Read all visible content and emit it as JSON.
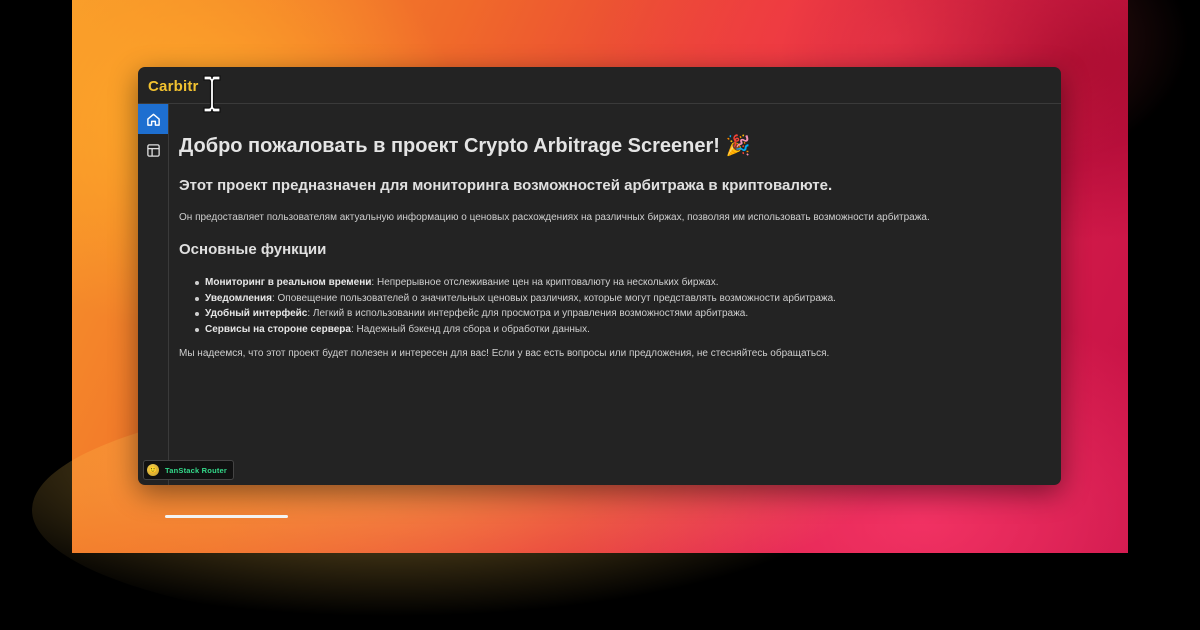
{
  "app": {
    "brand": "Carbitr"
  },
  "sidebar": {
    "items": [
      {
        "icon": "home-icon",
        "active": true
      },
      {
        "icon": "table-icon",
        "active": false
      }
    ]
  },
  "main": {
    "title": "Добро пожаловать в проект Crypto Arbitrage Screener! 🎉",
    "subtitle": "Этот проект предназначен для мониторинга возможностей арбитража в криптовалюте.",
    "intro": "Он предоставляет пользователям актуальную информацию о ценовых расхождениях на различных биржах, позволяя им использовать возможности арбитража.",
    "features_heading": "Основные функции",
    "features": [
      {
        "name": "Мониторинг в реальном времени",
        "desc": ": Непрерывное отслеживание цен на криптовалюту на нескольких биржах."
      },
      {
        "name": "Уведомления",
        "desc": ": Оповещение пользователей о значительных ценовых различиях, которые могут представлять возможности арбитража."
      },
      {
        "name": "Удобный интерфейс",
        "desc": ": Легкий в использовании интерфейс для просмотра и управления возможностями арбитража."
      },
      {
        "name": "Сервисы на стороне сервера",
        "desc": ": Надежный бэкенд для сбора и обработки данных."
      }
    ],
    "outro": "Мы надеемся, что этот проект будет полезен и интересен для вас! Если у вас есть вопросы или предложения, не стесняйтесь обращаться."
  },
  "devtools": {
    "label": "TanStack Router",
    "logo_emoji": "🙂"
  },
  "colors": {
    "accent": "#1e6fd0",
    "brand": "#f2c230",
    "window_bg": "#232323",
    "devtools_text": "#34d98a"
  }
}
